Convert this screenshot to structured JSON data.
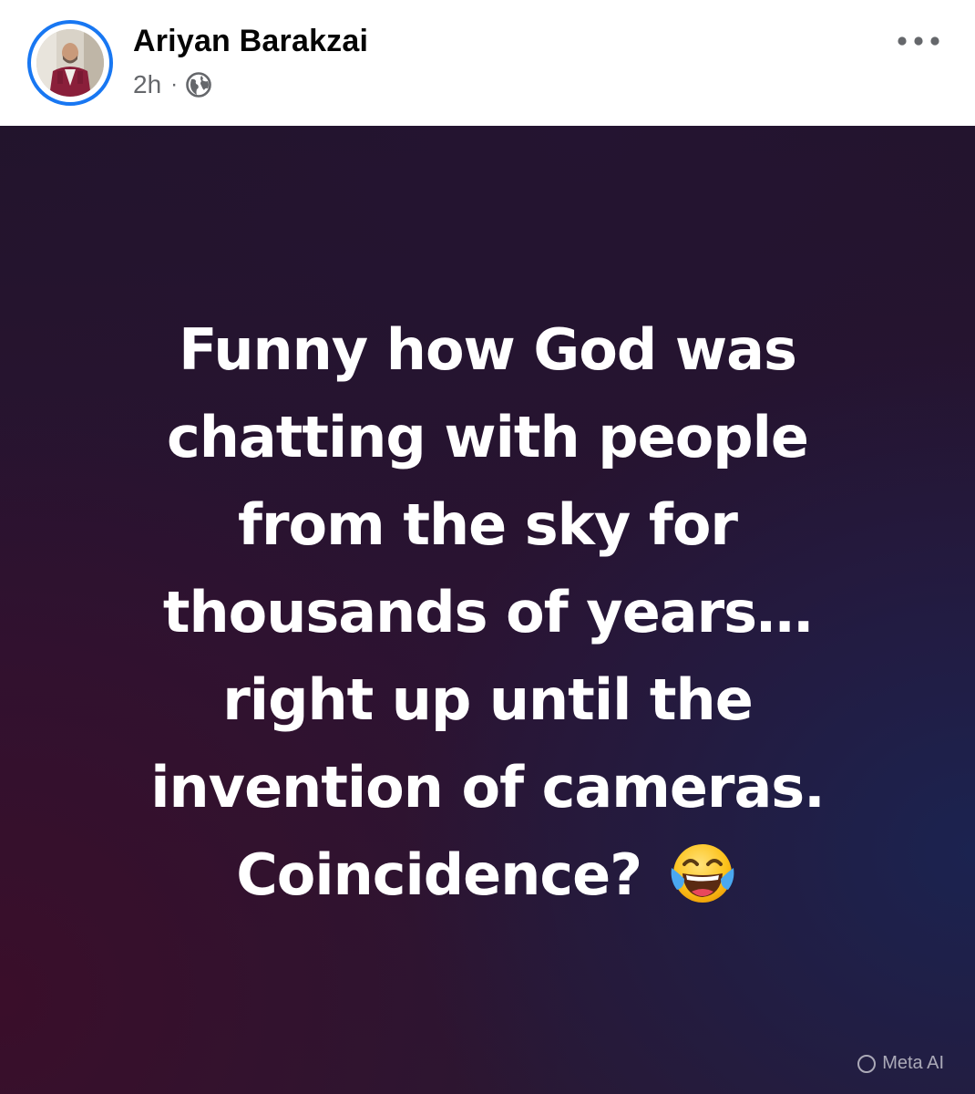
{
  "post": {
    "author": {
      "name": "Ariyan Barakzai",
      "avatar_icon": "profile-photo"
    },
    "meta": {
      "time": "2h",
      "separator": "·",
      "audience_icon": "globe-icon"
    },
    "more_icon": "more-horizontal-icon",
    "content": {
      "lines": [
        "Funny how God was",
        "chatting with people",
        "from the sky for",
        "thousands of years…",
        "right up until the",
        "invention of cameras.",
        "Coincidence?"
      ],
      "emoji": "😂",
      "emoji_icon": "face-with-tears-of-joy-icon"
    },
    "watermark": {
      "label": "Meta AI"
    },
    "colors": {
      "avatar_ring": "#1877f2",
      "text": "#ffffff",
      "meta_text": "#65676b"
    }
  }
}
